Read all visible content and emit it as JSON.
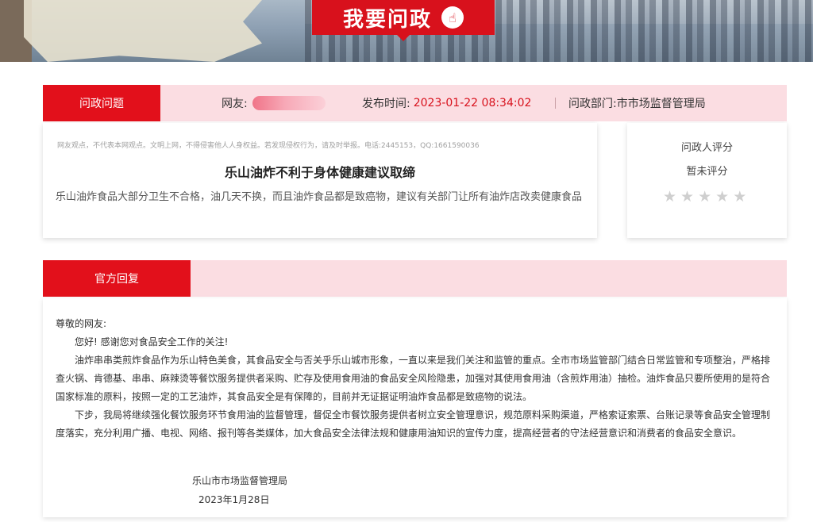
{
  "banner": {
    "title": "我要问政",
    "icon": "hand-pointer-icon",
    "color": "#d8111c"
  },
  "question": {
    "tab_label": "问政问题",
    "user_label": "网友:",
    "time_label": "发布时间:",
    "time_value": "2023-01-22 08:34:02",
    "dept_label": "问政部门:",
    "dept_value": "市市场监督管理局",
    "notice": "网友观点，不代表本网观点。文明上网，不得侵害他人人身权益。若发现侵权行为，请及时举报。电话:2445153，QQ:1661590036",
    "title": "乐山油炸不利于身体健康建议取缔",
    "body": "乐山油炸食品大部分卫生不合格，油几天不换，而且油炸食品都是致癌物，建议有关部门让所有油炸店改卖健康食品"
  },
  "rating": {
    "label": "问政人评分",
    "value": "暂未评分",
    "stars": 5,
    "filled": 0
  },
  "reply": {
    "tab_label": "官方回复",
    "greeting": "尊敬的网友:",
    "p1": "您好! 感谢您对食品安全工作的关注!",
    "p2": "油炸串串类煎炸食品作为乐山特色美食，其食品安全与否关乎乐山城市形象，一直以来是我们关注和监管的重点。全市市场监管部门结合日常监管和专项整治，严格排查火锅、肯德基、串串、麻辣烫等餐饮服务提供者采购、贮存及使用食用油的食品安全风险隐患，加强对其使用食用油（含煎炸用油）抽检。油炸食品只要所使用的是符合国家标准的原料，按照一定的工艺油炸，其食品安全是有保障的，目前并无证据证明油炸食品都是致癌物的说法。",
    "p3": "下步，我局将继续强化餐饮服务环节食用油的监督管理，督促全市餐饮服务提供者树立安全管理意识，规范原料采购渠道，严格索证索票、台账记录等食品安全管理制度落实，充分利用广播、电视、网络、报刊等各类媒体，加大食品安全法律法规和健康用油知识的宣传力度，提高经营者的守法经营意识和消费者的食品安全意识。",
    "signature": "乐山市市场监督管理局",
    "date": "2023年1月28日"
  }
}
